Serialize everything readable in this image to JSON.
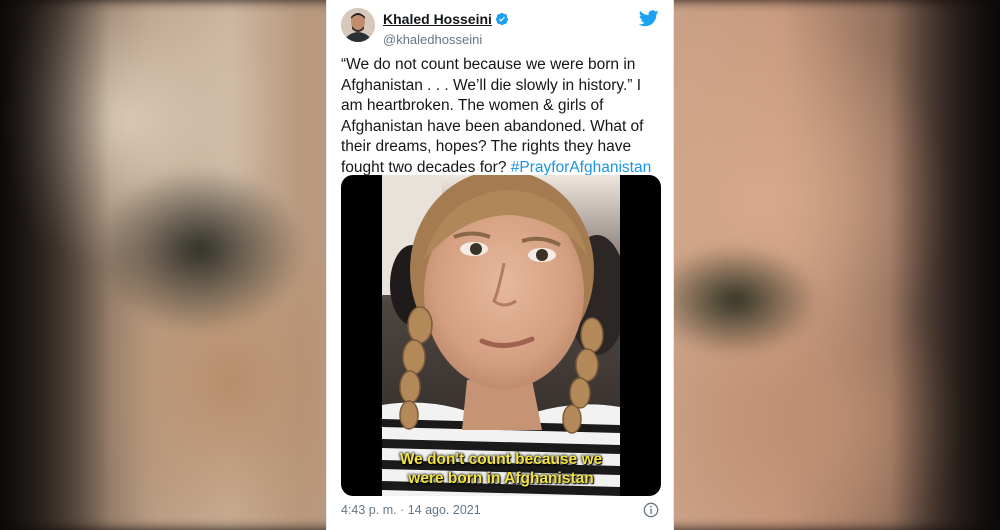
{
  "tweet": {
    "author_name": "Khaled Hosseini",
    "author_handle": "@khaledhosseini",
    "text_main": "“We do not count because we were born in Afghanistan . . . We’ll die slowly in history.” I am heartbroken. The women & girls of Afghanistan have been abandoned. What of their dreams, hopes? The rights they have fought two decades for? ",
    "hashtag": "#PrayforAfghanistan",
    "video_caption_line1": "We don't count because we",
    "video_caption_line2": "were born in Afghanistan",
    "timestamp": "4:43 p. m. · 14 ago. 2021"
  },
  "icons": {
    "platform": "twitter-bird-icon",
    "verified": "verified-badge-icon",
    "info": "info-icon"
  },
  "colors": {
    "link": "#1b95e0",
    "caption": "#f2e246",
    "verified": "#1da1f2"
  }
}
